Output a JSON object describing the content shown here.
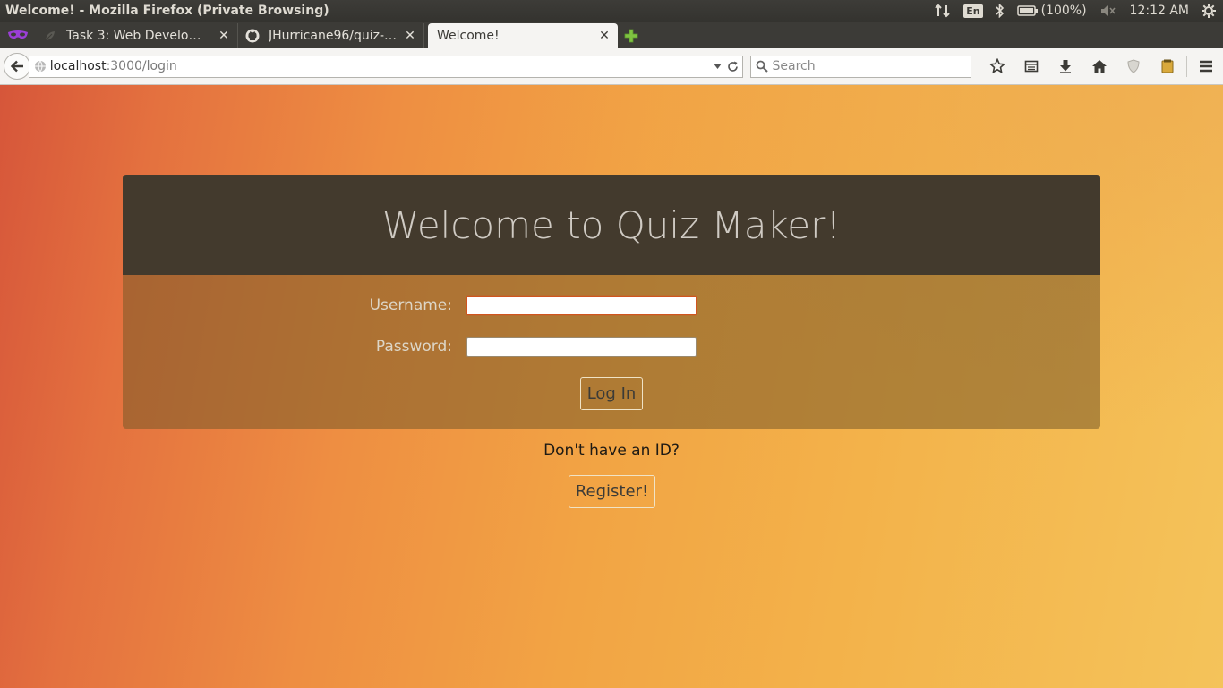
{
  "system_panel": {
    "window_title": "Welcome! - Mozilla Firefox (Private Browsing)",
    "keyboard_layout": "En",
    "battery": "(100%)",
    "clock": "12:12 AM",
    "icons": [
      "network-arrows-icon",
      "bluetooth-icon",
      "battery-icon",
      "volume-muted-icon",
      "settings-gear-icon"
    ]
  },
  "tabs": [
    {
      "label": "Task 3: Web Develo…",
      "icon": "leaf-icon",
      "active": false
    },
    {
      "label": "JHurricane96/quiz-…",
      "icon": "github-icon",
      "active": false
    },
    {
      "label": "Welcome!",
      "icon": "",
      "active": true
    }
  ],
  "navbar": {
    "url_host": "localhost",
    "url_path": ":3000/login",
    "search_placeholder": "Search"
  },
  "page": {
    "title": "Welcome to Quiz Maker!",
    "username_label": "Username:",
    "password_label": "Password:",
    "username_value": "",
    "password_value": "",
    "login_label": "Log In",
    "no_id_text": "Don't have an ID?",
    "register_label": "Register!"
  },
  "colors": {
    "card_header": "#433a2d",
    "focus_ring": "#d0541f",
    "page_gradient_start": "#d6563a",
    "page_gradient_end": "#f4c35a"
  }
}
